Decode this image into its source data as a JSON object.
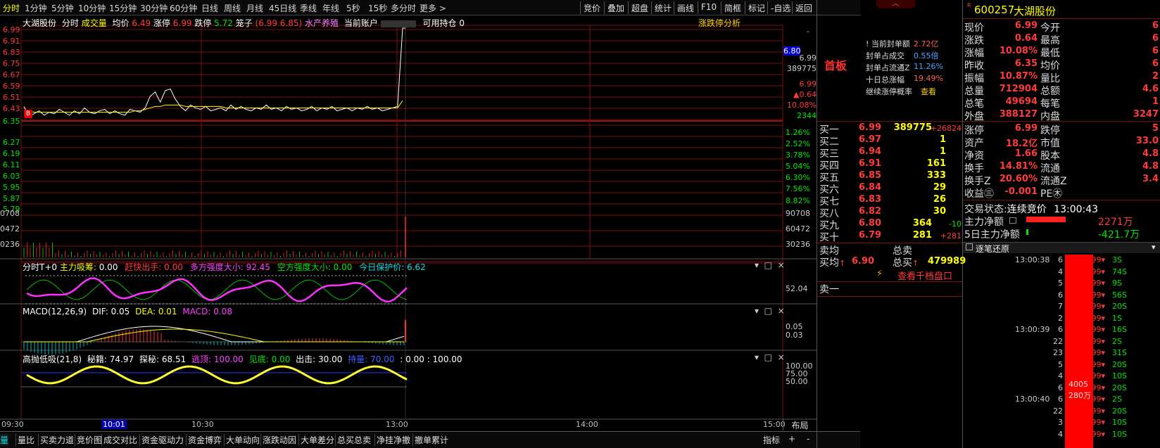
{
  "toolbar": {
    "periods": [
      "分时",
      "1分钟",
      "5分钟",
      "10分钟",
      "15分钟",
      "30分钟",
      "60分钟",
      "日线",
      "周线",
      "月线",
      "45日线",
      "季线",
      "年线",
      "5秒",
      "15秒",
      "多分时",
      "更多 >"
    ],
    "right_buttons": [
      "竞价",
      "叠加",
      "超盘",
      "统计",
      "画线",
      "F10",
      "简框",
      "标记",
      "-自选",
      "返回"
    ]
  },
  "chart": {
    "stock_name": "大湖股份",
    "mode": "分时",
    "volume_label": "成交量",
    "avg_label": "均价",
    "avg_value": "6.49",
    "limit_up_label": "涨停",
    "limit_up_value": "6.99",
    "limit_down_label": "跌停",
    "limit_down_value": "5.72",
    "cage_label": "笼子",
    "cage_value": "(6.99 6.85)",
    "asset_label": "水产养殖",
    "account_label": "当前账户",
    "position_label": "可用持仓",
    "position_value": "0",
    "analysis_btn": "涨跌停分析",
    "price_ticks": [
      "6.99",
      "6.91",
      "6.83",
      "6.75",
      "6.67",
      "6.59",
      "6.51",
      "6.43",
      "6.35",
      "6.27",
      "6.19",
      "6.11",
      "6.03",
      "5.95",
      "5.87",
      "5.79"
    ],
    "pct_ticks_right": [
      "1.26%",
      "2.52%",
      "3.78%",
      "5.04%",
      "6.30%",
      "7.56%",
      "8.82%"
    ],
    "vol_ticks": [
      "90708",
      "60472",
      "30236"
    ],
    "vol_ticks_left": [
      "0708",
      "0472",
      "0236"
    ],
    "cursor_price": "6.80",
    "right_cursor_stats": [
      "6.99",
      "389775",
      "6.99",
      "▲0.64",
      "10.08%",
      "2344"
    ],
    "b_marker": "B",
    "price_series": [
      6.45,
      6.38,
      6.4,
      6.42,
      6.39,
      6.41,
      6.4,
      6.43,
      6.41,
      6.39,
      6.42,
      6.4,
      6.44,
      6.41,
      6.4,
      6.42,
      6.43,
      6.4,
      6.42,
      6.4,
      6.39,
      6.43,
      6.42,
      6.41,
      6.44,
      6.52,
      6.55,
      6.48,
      6.56,
      6.57,
      6.5,
      6.45,
      6.42,
      6.46,
      6.44,
      6.43,
      6.45,
      6.42,
      6.43,
      6.44,
      6.42,
      6.46,
      6.43,
      6.45,
      6.43,
      6.42,
      6.44,
      6.43,
      6.46,
      6.43,
      6.44,
      6.42,
      6.45,
      6.43,
      6.44,
      6.42,
      6.43,
      6.45,
      6.42,
      6.44,
      6.43,
      6.45,
      6.42,
      6.43,
      6.44,
      6.42,
      6.44,
      6.43,
      6.45,
      6.43,
      6.44,
      6.42,
      6.43,
      6.44,
      6.45,
      6.99
    ],
    "avg_series": [
      6.42,
      6.42,
      6.41,
      6.41,
      6.41,
      6.41,
      6.41,
      6.41,
      6.41,
      6.41,
      6.41,
      6.41,
      6.41,
      6.41,
      6.41,
      6.41,
      6.41,
      6.41,
      6.41,
      6.41,
      6.41,
      6.41,
      6.42,
      6.42,
      6.43,
      6.44,
      6.45,
      6.45,
      6.46,
      6.46,
      6.46,
      6.46,
      6.45,
      6.45,
      6.45,
      6.45,
      6.45,
      6.45,
      6.45,
      6.45,
      6.44,
      6.44,
      6.44,
      6.44,
      6.44,
      6.44,
      6.44,
      6.44,
      6.44,
      6.44,
      6.44,
      6.44,
      6.44,
      6.44,
      6.44,
      6.44,
      6.44,
      6.44,
      6.44,
      6.44,
      6.44,
      6.44,
      6.44,
      6.44,
      6.44,
      6.44,
      6.44,
      6.44,
      6.44,
      6.44,
      6.44,
      6.44,
      6.44,
      6.44,
      6.44,
      6.49
    ]
  },
  "panel_t0": {
    "title": "分时T+0",
    "f1_label": "主力吸筹:",
    "f1_value": "0.00",
    "f2_label": "赶快出手:",
    "f2_value": "0.00",
    "f3_label": "多方强度大小:",
    "f3_value": "92.45",
    "f4_label": "空方强度大小:",
    "f4_value": "0.00",
    "f5_label": "今日保护价:",
    "f5_value": "6.62",
    "right_tick": "52.04"
  },
  "panel_macd": {
    "title": "MACD(12,26,9)",
    "dif_label": "DIF:",
    "dif_value": "0.05",
    "dea_label": "DEA:",
    "dea_value": "0.01",
    "macd_label": "MACD:",
    "macd_value": "0.08",
    "right_ticks": [
      "0.05",
      "0.03"
    ]
  },
  "panel_gpdx": {
    "title": "高抛低吸(21,8)",
    "a_label": "秘籍:",
    "a_value": "74.97",
    "b_label": "探秘:",
    "b_value": "68.51",
    "c_label": "逃顶:",
    "c_value": "100.00",
    "d_label": "见底:",
    "d_value": "0.00",
    "e_label": "出击:",
    "e_value": "30.00",
    "f_label": "持量:",
    "f_value": "70.00",
    "g_value": ": 0.00 : 100.00",
    "right_ticks": [
      "100.00",
      "75.00",
      "50.00"
    ]
  },
  "time_axis": [
    "09:30",
    "10:01",
    "10:30",
    "13:00",
    "14:00",
    "15:00"
  ],
  "layout_btn": "布局",
  "bottom_tabs": [
    "量比",
    "买卖力道",
    "竞价图",
    "成交对比",
    "资金驱动力",
    "资金博弈",
    "大单动向",
    "涨跌动因",
    "大单差分",
    "总买总卖",
    "净挂净撤",
    "撤单累计"
  ],
  "bottom_tab_left_fragment": "量",
  "bottom_right": [
    "指标",
    "+",
    "-"
  ],
  "seal": {
    "title": "首板",
    "rows": [
      {
        "label": "当前封单额",
        "value": "2.72亿"
      },
      {
        "label": "封单占成交",
        "value": "0.55倍"
      },
      {
        "label": "封单占流通Z",
        "value": "11.26%"
      },
      {
        "label": "十日总涨幅",
        "value": "19.49%"
      },
      {
        "label": "继续涨停概率",
        "value": "查看"
      }
    ]
  },
  "orderbook": {
    "bids": [
      {
        "label": "买一",
        "price": "6.99",
        "vol": "389775",
        "chg": "+26824"
      },
      {
        "label": "买二",
        "price": "6.97",
        "vol": "1",
        "chg": ""
      },
      {
        "label": "买三",
        "price": "6.94",
        "vol": "1",
        "chg": ""
      },
      {
        "label": "买四",
        "price": "6.91",
        "vol": "161",
        "chg": ""
      },
      {
        "label": "买五",
        "price": "6.85",
        "vol": "333",
        "chg": ""
      },
      {
        "label": "买六",
        "price": "6.84",
        "vol": "29",
        "chg": ""
      },
      {
        "label": "买七",
        "price": "6.83",
        "vol": "26",
        "chg": ""
      },
      {
        "label": "买八",
        "price": "6.82",
        "vol": "30",
        "chg": ""
      },
      {
        "label": "买九",
        "price": "6.80",
        "vol": "364",
        "chg": "-10"
      },
      {
        "label": "买十",
        "price": "6.79",
        "vol": "281",
        "chg": "+281"
      }
    ],
    "sell_avg_label": "卖均",
    "sell_total_label": "总卖",
    "buy_avg_label": "买均",
    "buy_avg_value": "6.90",
    "buy_total_label": "总买",
    "buy_total_value": "479989",
    "depth_btn": "查看千档盘口",
    "ask1_label": "卖一"
  },
  "quote": {
    "flag": "R",
    "code": "600257",
    "name": "大湖股份",
    "rows": [
      {
        "l1": "现价",
        "v1": "6.99",
        "l2": "今开",
        "v2": "6"
      },
      {
        "l1": "涨跌",
        "v1": "0.64",
        "l2": "最高",
        "v2": "6"
      },
      {
        "l1": "涨幅",
        "v1": "10.08%",
        "l2": "最低",
        "v2": "6"
      },
      {
        "l1": "昨收",
        "v1": "6.35",
        "l2": "均价",
        "v2": "6"
      },
      {
        "l1": "振幅",
        "v1": "10.87%",
        "l2": "量比",
        "v2": "2"
      },
      {
        "l1": "总量",
        "v1": "712904",
        "l2": "总额",
        "v2": "4.6"
      },
      {
        "l1": "总笔",
        "v1": "49694",
        "l2": "每笔",
        "v2": "1"
      },
      {
        "l1": "外盘",
        "v1": "388127",
        "l2": "内盘",
        "v2": "3247"
      }
    ],
    "rows2": [
      {
        "l1": "涨停",
        "v1": "6.99",
        "l2": "跌停",
        "v2": "5"
      },
      {
        "l1": "资产",
        "v1": "18.2亿",
        "l2": "市值",
        "v2": "33.0"
      },
      {
        "l1": "净资",
        "v1": "1.66",
        "l2": "股本",
        "v2": "4.8"
      },
      {
        "l1": "换手",
        "v1": "14.81%",
        "l2": "流通",
        "v2": "4.8"
      },
      {
        "l1": "换手Z",
        "v1": "20.60%",
        "l2": "流通Z",
        "v2": "3.4"
      },
      {
        "l1": "收益㊂",
        "v1": "-0.001",
        "l2": "PE㊍",
        "v2": ""
      }
    ],
    "trade_state_label": "交易状态:",
    "trade_state_value": "连续竞价",
    "trade_time": "13:00:43",
    "main_net_label": "主力净额",
    "main_net_value": "2271万",
    "main_net5_label": "5日主力净额",
    "main_net5_value": "-421.7万"
  },
  "ticks": {
    "title": "逐笔还原",
    "rows": [
      {
        "t": "13:00:38",
        "n": "6",
        "p": "6.99",
        "v": "3S"
      },
      {
        "t": "",
        "n": "4",
        "p": "6.99",
        "v": "74S"
      },
      {
        "t": "",
        "n": "5",
        "p": "6.99",
        "v": "9S"
      },
      {
        "t": "",
        "n": "6",
        "p": "6.99",
        "v": "56S"
      },
      {
        "t": "",
        "n": "7",
        "p": "6.99",
        "v": "20S"
      },
      {
        "t": "",
        "n": "2",
        "p": "6.99",
        "v": "1S"
      },
      {
        "t": "13:00:39",
        "n": "6",
        "p": "6.99",
        "v": "16S"
      },
      {
        "t": "",
        "n": "22",
        "p": "6.99",
        "v": "2S"
      },
      {
        "t": "",
        "n": "23",
        "p": "6.99",
        "v": "31S"
      },
      {
        "t": "",
        "n": "5",
        "p": "6.99",
        "v": "20S"
      },
      {
        "t": "",
        "n": "4",
        "p": "6.99",
        "v": "10S"
      },
      {
        "t": "",
        "n": "6",
        "p": "6.99",
        "v": "20S"
      },
      {
        "t": "13:00:40",
        "n": "6",
        "p": "6.99",
        "v": "2S"
      },
      {
        "t": "",
        "n": "22",
        "p": "6.99",
        "v": "20S"
      },
      {
        "t": "",
        "n": "3",
        "p": "6.99",
        "v": "10S"
      },
      {
        "t": "",
        "n": "4",
        "p": "6.99",
        "v": "10S"
      }
    ],
    "bar_text1": "4005",
    "bar_text2": "280万"
  },
  "colors": {
    "up": "#ff3c3c",
    "down": "#00e600",
    "avg": "#ffff00",
    "grid": "#7a1010",
    "bg": "#000000"
  }
}
